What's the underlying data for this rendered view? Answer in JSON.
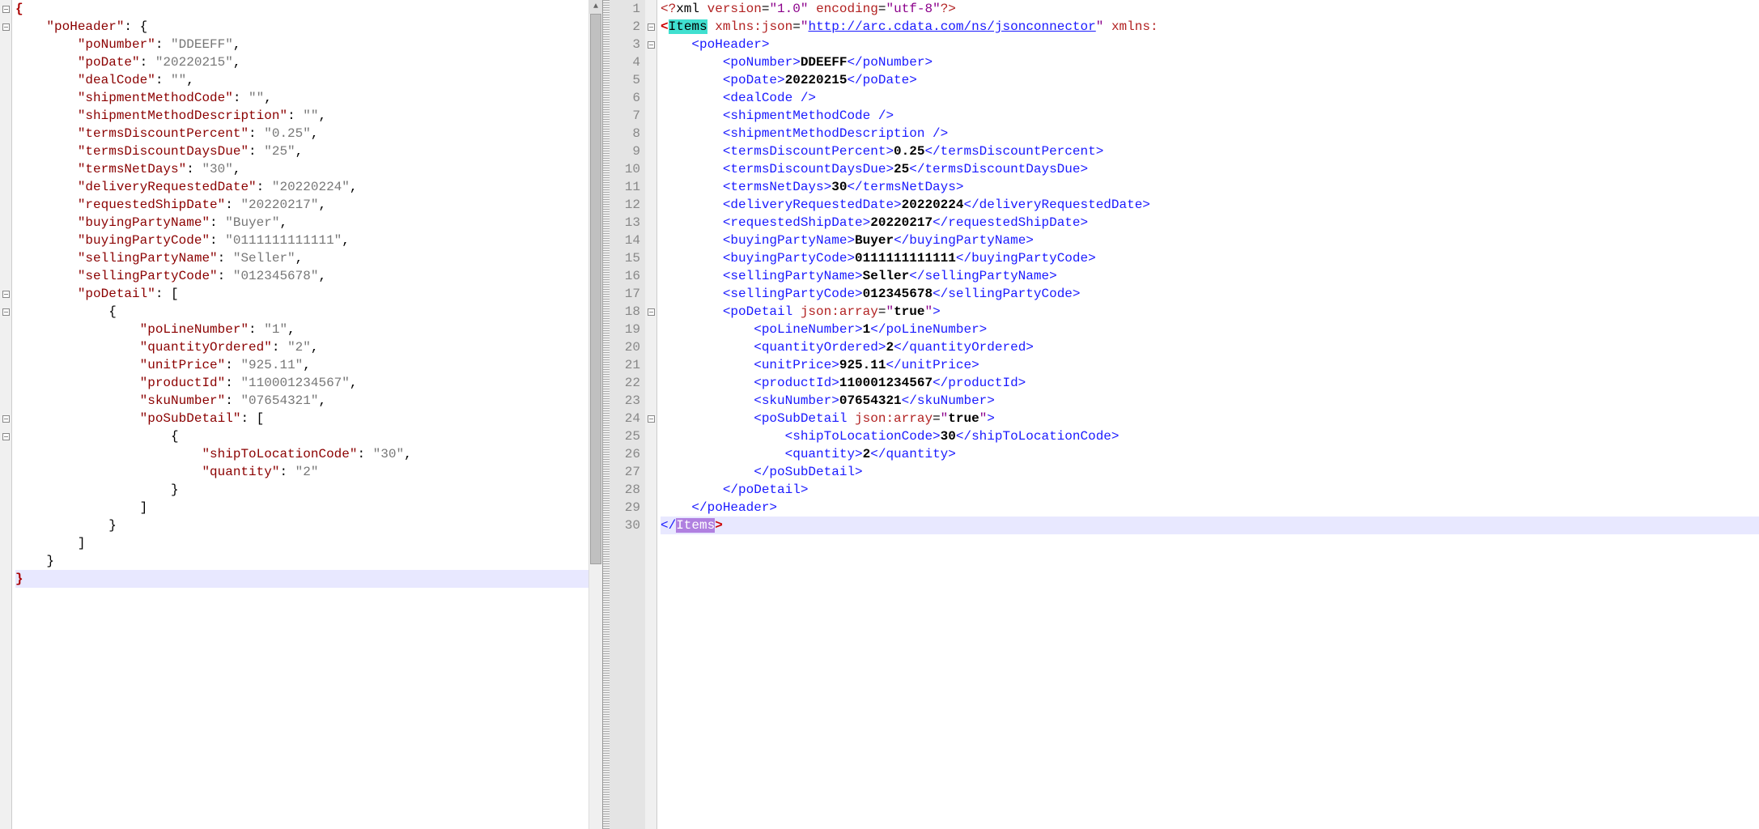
{
  "left": {
    "lines": [
      {
        "indent": 0,
        "tokens": [
          {
            "t": "j-brace",
            "v": "{"
          }
        ],
        "fold": true
      },
      {
        "indent": 1,
        "tokens": [
          {
            "t": "j-key",
            "v": "\"poHeader\""
          },
          {
            "t": "",
            "v": ": {"
          }
        ],
        "fold": true
      },
      {
        "indent": 2,
        "tokens": [
          {
            "t": "j-key",
            "v": "\"poNumber\""
          },
          {
            "t": "",
            "v": ": "
          },
          {
            "t": "j-str",
            "v": "\"DDEEFF\""
          },
          {
            "t": "",
            "v": ","
          }
        ]
      },
      {
        "indent": 2,
        "tokens": [
          {
            "t": "j-key",
            "v": "\"poDate\""
          },
          {
            "t": "",
            "v": ": "
          },
          {
            "t": "j-str",
            "v": "\"20220215\""
          },
          {
            "t": "",
            "v": ","
          }
        ]
      },
      {
        "indent": 2,
        "tokens": [
          {
            "t": "j-key",
            "v": "\"dealCode\""
          },
          {
            "t": "",
            "v": ": "
          },
          {
            "t": "j-str",
            "v": "\"\""
          },
          {
            "t": "",
            "v": ","
          }
        ]
      },
      {
        "indent": 2,
        "tokens": [
          {
            "t": "j-key",
            "v": "\"shipmentMethodCode\""
          },
          {
            "t": "",
            "v": ": "
          },
          {
            "t": "j-str",
            "v": "\"\""
          },
          {
            "t": "",
            "v": ","
          }
        ]
      },
      {
        "indent": 2,
        "tokens": [
          {
            "t": "j-key",
            "v": "\"shipmentMethodDescription\""
          },
          {
            "t": "",
            "v": ": "
          },
          {
            "t": "j-str",
            "v": "\"\""
          },
          {
            "t": "",
            "v": ","
          }
        ]
      },
      {
        "indent": 2,
        "tokens": [
          {
            "t": "j-key",
            "v": "\"termsDiscountPercent\""
          },
          {
            "t": "",
            "v": ": "
          },
          {
            "t": "j-str",
            "v": "\"0.25\""
          },
          {
            "t": "",
            "v": ","
          }
        ]
      },
      {
        "indent": 2,
        "tokens": [
          {
            "t": "j-key",
            "v": "\"termsDiscountDaysDue\""
          },
          {
            "t": "",
            "v": ": "
          },
          {
            "t": "j-str",
            "v": "\"25\""
          },
          {
            "t": "",
            "v": ","
          }
        ]
      },
      {
        "indent": 2,
        "tokens": [
          {
            "t": "j-key",
            "v": "\"termsNetDays\""
          },
          {
            "t": "",
            "v": ": "
          },
          {
            "t": "j-str",
            "v": "\"30\""
          },
          {
            "t": "",
            "v": ","
          }
        ]
      },
      {
        "indent": 2,
        "tokens": [
          {
            "t": "j-key",
            "v": "\"deliveryRequestedDate\""
          },
          {
            "t": "",
            "v": ": "
          },
          {
            "t": "j-str",
            "v": "\"20220224\""
          },
          {
            "t": "",
            "v": ","
          }
        ]
      },
      {
        "indent": 2,
        "tokens": [
          {
            "t": "j-key",
            "v": "\"requestedShipDate\""
          },
          {
            "t": "",
            "v": ": "
          },
          {
            "t": "j-str",
            "v": "\"20220217\""
          },
          {
            "t": "",
            "v": ","
          }
        ]
      },
      {
        "indent": 2,
        "tokens": [
          {
            "t": "j-key",
            "v": "\"buyingPartyName\""
          },
          {
            "t": "",
            "v": ": "
          },
          {
            "t": "j-str",
            "v": "\"Buyer\""
          },
          {
            "t": "",
            "v": ","
          }
        ]
      },
      {
        "indent": 2,
        "tokens": [
          {
            "t": "j-key",
            "v": "\"buyingPartyCode\""
          },
          {
            "t": "",
            "v": ": "
          },
          {
            "t": "j-str",
            "v": "\"0111111111111\""
          },
          {
            "t": "",
            "v": ","
          }
        ]
      },
      {
        "indent": 2,
        "tokens": [
          {
            "t": "j-key",
            "v": "\"sellingPartyName\""
          },
          {
            "t": "",
            "v": ": "
          },
          {
            "t": "j-str",
            "v": "\"Seller\""
          },
          {
            "t": "",
            "v": ","
          }
        ]
      },
      {
        "indent": 2,
        "tokens": [
          {
            "t": "j-key",
            "v": "\"sellingPartyCode\""
          },
          {
            "t": "",
            "v": ": "
          },
          {
            "t": "j-str",
            "v": "\"012345678\""
          },
          {
            "t": "",
            "v": ","
          }
        ]
      },
      {
        "indent": 2,
        "tokens": [
          {
            "t": "j-key",
            "v": "\"poDetail\""
          },
          {
            "t": "",
            "v": ": ["
          }
        ],
        "fold": true
      },
      {
        "indent": 3,
        "tokens": [
          {
            "t": "",
            "v": "{"
          }
        ],
        "fold": true
      },
      {
        "indent": 4,
        "tokens": [
          {
            "t": "j-key",
            "v": "\"poLineNumber\""
          },
          {
            "t": "",
            "v": ": "
          },
          {
            "t": "j-str",
            "v": "\"1\""
          },
          {
            "t": "",
            "v": ","
          }
        ]
      },
      {
        "indent": 4,
        "tokens": [
          {
            "t": "j-key",
            "v": "\"quantityOrdered\""
          },
          {
            "t": "",
            "v": ": "
          },
          {
            "t": "j-str",
            "v": "\"2\""
          },
          {
            "t": "",
            "v": ","
          }
        ]
      },
      {
        "indent": 4,
        "tokens": [
          {
            "t": "j-key",
            "v": "\"unitPrice\""
          },
          {
            "t": "",
            "v": ": "
          },
          {
            "t": "j-str",
            "v": "\"925.11\""
          },
          {
            "t": "",
            "v": ","
          }
        ]
      },
      {
        "indent": 4,
        "tokens": [
          {
            "t": "j-key",
            "v": "\"productId\""
          },
          {
            "t": "",
            "v": ": "
          },
          {
            "t": "j-str",
            "v": "\"110001234567\""
          },
          {
            "t": "",
            "v": ","
          }
        ]
      },
      {
        "indent": 4,
        "tokens": [
          {
            "t": "j-key",
            "v": "\"skuNumber\""
          },
          {
            "t": "",
            "v": ": "
          },
          {
            "t": "j-str",
            "v": "\"07654321\""
          },
          {
            "t": "",
            "v": ","
          }
        ]
      },
      {
        "indent": 4,
        "tokens": [
          {
            "t": "j-key",
            "v": "\"poSubDetail\""
          },
          {
            "t": "",
            "v": ": ["
          }
        ],
        "fold": true
      },
      {
        "indent": 5,
        "tokens": [
          {
            "t": "",
            "v": "{"
          }
        ],
        "fold": true
      },
      {
        "indent": 6,
        "tokens": [
          {
            "t": "j-key",
            "v": "\"shipToLocationCode\""
          },
          {
            "t": "",
            "v": ": "
          },
          {
            "t": "j-str",
            "v": "\"30\""
          },
          {
            "t": "",
            "v": ","
          }
        ]
      },
      {
        "indent": 6,
        "tokens": [
          {
            "t": "j-key",
            "v": "\"quantity\""
          },
          {
            "t": "",
            "v": ": "
          },
          {
            "t": "j-str",
            "v": "\"2\""
          }
        ]
      },
      {
        "indent": 5,
        "tokens": [
          {
            "t": "",
            "v": "}"
          }
        ]
      },
      {
        "indent": 4,
        "tokens": [
          {
            "t": "",
            "v": "]"
          }
        ]
      },
      {
        "indent": 3,
        "tokens": [
          {
            "t": "",
            "v": "}"
          }
        ]
      },
      {
        "indent": 2,
        "tokens": [
          {
            "t": "",
            "v": "]"
          }
        ]
      },
      {
        "indent": 1,
        "tokens": [
          {
            "t": "",
            "v": "}"
          }
        ]
      },
      {
        "indent": 0,
        "tokens": [
          {
            "t": "j-brace",
            "v": "}"
          }
        ],
        "cursor": true
      }
    ]
  },
  "right": {
    "lines": [
      {
        "n": 1,
        "indent": 0,
        "tokens": [
          {
            "t": "x-pi-bg",
            "raw": "<span class='x-pi'>&lt;?</span>xml <span class='x-attr'>version</span>=<span class='x-aval'>\"1.0\"</span> <span class='x-attr'>encoding</span>=<span class='x-aval'>\"utf-8\"</span><span class='x-pi'>?&gt;</span>"
          }
        ]
      },
      {
        "n": 2,
        "indent": 0,
        "fold": true,
        "tokens": [
          {
            "raw": "<span class='red-angle'>&lt;</span><span class='hl-open'>Items</span> <span class='x-attr'>xmlns:json</span>=<span class='x-aval'>\"</span><span class='x-url'>http://arc.cdata.com/ns/jsonconnector</span><span class='x-aval'>\"</span> <span class='x-attr'>xmlns:</span>"
          }
        ]
      },
      {
        "n": 3,
        "indent": 1,
        "fold": true,
        "tokens": [
          {
            "raw": "<span class='x-tag'>&lt;poHeader&gt;</span>"
          }
        ]
      },
      {
        "n": 4,
        "indent": 2,
        "tokens": [
          {
            "raw": "<span class='x-tag'>&lt;poNumber&gt;</span><span class='x-text'>DDEEFF</span><span class='x-tag'>&lt;/poNumber&gt;</span>"
          }
        ]
      },
      {
        "n": 5,
        "indent": 2,
        "tokens": [
          {
            "raw": "<span class='x-tag'>&lt;poDate&gt;</span><span class='x-text'>20220215</span><span class='x-tag'>&lt;/poDate&gt;</span>"
          }
        ]
      },
      {
        "n": 6,
        "indent": 2,
        "tokens": [
          {
            "raw": "<span class='x-tag'>&lt;dealCode /&gt;</span>"
          }
        ]
      },
      {
        "n": 7,
        "indent": 2,
        "tokens": [
          {
            "raw": "<span class='x-tag'>&lt;shipmentMethodCode /&gt;</span>"
          }
        ]
      },
      {
        "n": 8,
        "indent": 2,
        "tokens": [
          {
            "raw": "<span class='x-tag'>&lt;shipmentMethodDescription /&gt;</span>"
          }
        ]
      },
      {
        "n": 9,
        "indent": 2,
        "tokens": [
          {
            "raw": "<span class='x-tag'>&lt;termsDiscountPercent&gt;</span><span class='x-text'>0.25</span><span class='x-tag'>&lt;/termsDiscountPercent&gt;</span>"
          }
        ]
      },
      {
        "n": 10,
        "indent": 2,
        "tokens": [
          {
            "raw": "<span class='x-tag'>&lt;termsDiscountDaysDue&gt;</span><span class='x-text'>25</span><span class='x-tag'>&lt;/termsDiscountDaysDue&gt;</span>"
          }
        ]
      },
      {
        "n": 11,
        "indent": 2,
        "tokens": [
          {
            "raw": "<span class='x-tag'>&lt;termsNetDays&gt;</span><span class='x-text'>30</span><span class='x-tag'>&lt;/termsNetDays&gt;</span>"
          }
        ]
      },
      {
        "n": 12,
        "indent": 2,
        "tokens": [
          {
            "raw": "<span class='x-tag'>&lt;deliveryRequestedDate&gt;</span><span class='x-text'>20220224</span><span class='x-tag'>&lt;/deliveryRequestedDate&gt;</span>"
          }
        ]
      },
      {
        "n": 13,
        "indent": 2,
        "tokens": [
          {
            "raw": "<span class='x-tag'>&lt;requestedShipDate&gt;</span><span class='x-text'>20220217</span><span class='x-tag'>&lt;/requestedShipDate&gt;</span>"
          }
        ]
      },
      {
        "n": 14,
        "indent": 2,
        "tokens": [
          {
            "raw": "<span class='x-tag'>&lt;buyingPartyName&gt;</span><span class='x-text'>Buyer</span><span class='x-tag'>&lt;/buyingPartyName&gt;</span>"
          }
        ]
      },
      {
        "n": 15,
        "indent": 2,
        "tokens": [
          {
            "raw": "<span class='x-tag'>&lt;buyingPartyCode&gt;</span><span class='x-text'>0111111111111</span><span class='x-tag'>&lt;/buyingPartyCode&gt;</span>"
          }
        ]
      },
      {
        "n": 16,
        "indent": 2,
        "tokens": [
          {
            "raw": "<span class='x-tag'>&lt;sellingPartyName&gt;</span><span class='x-text'>Seller</span><span class='x-tag'>&lt;/sellingPartyName&gt;</span>"
          }
        ]
      },
      {
        "n": 17,
        "indent": 2,
        "tokens": [
          {
            "raw": "<span class='x-tag'>&lt;sellingPartyCode&gt;</span><span class='x-text'>012345678</span><span class='x-tag'>&lt;/sellingPartyCode&gt;</span>"
          }
        ]
      },
      {
        "n": 18,
        "indent": 2,
        "fold": true,
        "tokens": [
          {
            "raw": "<span class='x-tag'>&lt;poDetail </span><span class='x-attr'>json:array</span>=<span class='x-aval'>\"</span><span class='x-text'>true</span><span class='x-aval'>\"</span><span class='x-tag'>&gt;</span>"
          }
        ]
      },
      {
        "n": 19,
        "indent": 3,
        "tokens": [
          {
            "raw": "<span class='x-tag'>&lt;poLineNumber&gt;</span><span class='x-text'>1</span><span class='x-tag'>&lt;/poLineNumber&gt;</span>"
          }
        ]
      },
      {
        "n": 20,
        "indent": 3,
        "tokens": [
          {
            "raw": "<span class='x-tag'>&lt;quantityOrdered&gt;</span><span class='x-text'>2</span><span class='x-tag'>&lt;/quantityOrdered&gt;</span>"
          }
        ]
      },
      {
        "n": 21,
        "indent": 3,
        "tokens": [
          {
            "raw": "<span class='x-tag'>&lt;unitPrice&gt;</span><span class='x-text'>925.11</span><span class='x-tag'>&lt;/unitPrice&gt;</span>"
          }
        ]
      },
      {
        "n": 22,
        "indent": 3,
        "tokens": [
          {
            "raw": "<span class='x-tag'>&lt;productId&gt;</span><span class='x-text'>110001234567</span><span class='x-tag'>&lt;/productId&gt;</span>"
          }
        ]
      },
      {
        "n": 23,
        "indent": 3,
        "tokens": [
          {
            "raw": "<span class='x-tag'>&lt;skuNumber&gt;</span><span class='x-text'>07654321</span><span class='x-tag'>&lt;/skuNumber&gt;</span>"
          }
        ]
      },
      {
        "n": 24,
        "indent": 3,
        "fold": true,
        "tokens": [
          {
            "raw": "<span class='x-tag'>&lt;poSubDetail </span><span class='x-attr'>json:array</span>=<span class='x-aval'>\"</span><span class='x-text'>true</span><span class='x-aval'>\"</span><span class='x-tag'>&gt;</span>"
          }
        ]
      },
      {
        "n": 25,
        "indent": 4,
        "tokens": [
          {
            "raw": "<span class='x-tag'>&lt;shipToLocationCode&gt;</span><span class='x-text'>30</span><span class='x-tag'>&lt;/shipToLocationCode&gt;</span>"
          }
        ]
      },
      {
        "n": 26,
        "indent": 4,
        "tokens": [
          {
            "raw": "<span class='x-tag'>&lt;quantity&gt;</span><span class='x-text'>2</span><span class='x-tag'>&lt;/quantity&gt;</span>"
          }
        ]
      },
      {
        "n": 27,
        "indent": 3,
        "tokens": [
          {
            "raw": "<span class='x-tag'>&lt;/poSubDetail&gt;</span>"
          }
        ]
      },
      {
        "n": 28,
        "indent": 2,
        "tokens": [
          {
            "raw": "<span class='x-tag'>&lt;/poDetail&gt;</span>"
          }
        ]
      },
      {
        "n": 29,
        "indent": 1,
        "tokens": [
          {
            "raw": "<span class='x-tag'>&lt;/poHeader&gt;</span>"
          }
        ]
      },
      {
        "n": 30,
        "indent": 0,
        "cursor": true,
        "tokens": [
          {
            "raw": "<span class='x-tag'>&lt;/</span><span class='hl-close'>Items</span><span class='red-angle'>&gt;</span>"
          }
        ]
      }
    ]
  }
}
